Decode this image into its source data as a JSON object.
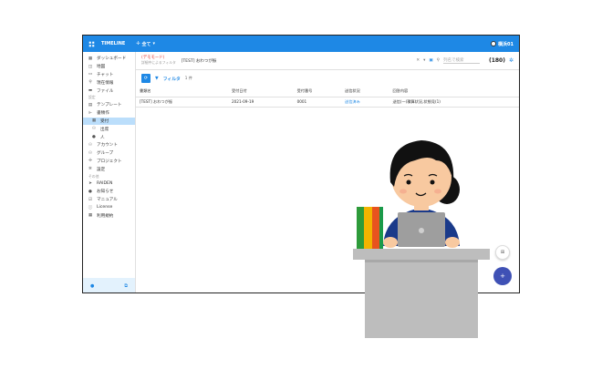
{
  "topbar": {
    "title": "TIMELINE",
    "scope": "全て",
    "user": "横浜01"
  },
  "sidebar": {
    "items": [
      {
        "icon": "grid-icon",
        "glyph": "▦",
        "label": "ダッシュボード"
      },
      {
        "icon": "map-icon",
        "glyph": "◫",
        "label": "地図"
      },
      {
        "icon": "chat-icon",
        "glyph": "▭",
        "label": "チャット"
      },
      {
        "icon": "location-icon",
        "glyph": "⚲",
        "label": "現在情報"
      },
      {
        "icon": "folder-icon",
        "glyph": "▬",
        "label": "ファイル"
      }
    ],
    "section_settings": "設定",
    "settings_items": [
      {
        "icon": "template-icon",
        "glyph": "▤",
        "label": "テンプレート"
      },
      {
        "icon": "form-icon",
        "glyph": "⊩",
        "label": "書類作"
      }
    ],
    "sub_items": [
      {
        "icon": "inbox-icon",
        "glyph": "▦",
        "label": "受付",
        "active": true
      },
      {
        "icon": "user-group-icon",
        "glyph": "⚇",
        "label": "出席"
      },
      {
        "icon": "person-icon",
        "glyph": "●",
        "label": "人"
      }
    ],
    "more_items": [
      {
        "icon": "account-icon",
        "glyph": "⚇",
        "label": "アカウント"
      },
      {
        "icon": "group-icon",
        "glyph": "⚇",
        "label": "グループ"
      },
      {
        "icon": "project-icon",
        "glyph": "✢",
        "label": "プロジェクト"
      },
      {
        "icon": "gear-icon",
        "glyph": "✲",
        "label": "設定"
      }
    ],
    "section_other": "その他",
    "other_items": [
      {
        "icon": "send-icon",
        "glyph": "➤",
        "label": "RAIDEN"
      },
      {
        "icon": "bell-icon",
        "glyph": "●",
        "label": "お知らせ"
      },
      {
        "icon": "manual-icon",
        "glyph": "☑",
        "label": "マニュアル"
      },
      {
        "icon": "info-icon",
        "glyph": "ⓘ",
        "label": "License"
      },
      {
        "icon": "terms-icon",
        "glyph": "▦",
        "label": "利用規約"
      }
    ]
  },
  "search": {
    "tag": "(デモモード)",
    "tag_sub": "詳細中によるフィルタ",
    "query": "[TEST] おわつが振",
    "placeholder": "列名で検索",
    "count": "(180)"
  },
  "filter": {
    "label": "フィルタ",
    "count": "1 件"
  },
  "table": {
    "headers": [
      "書類名",
      "受付日付",
      "受付番号",
      "送信状況",
      "回答内容"
    ],
    "rows": [
      [
        "[TEST] おわつが振",
        "2021-09-19",
        "0001",
        "送信済み",
        "送信(一)積算状況,状態見(1)"
      ]
    ]
  }
}
